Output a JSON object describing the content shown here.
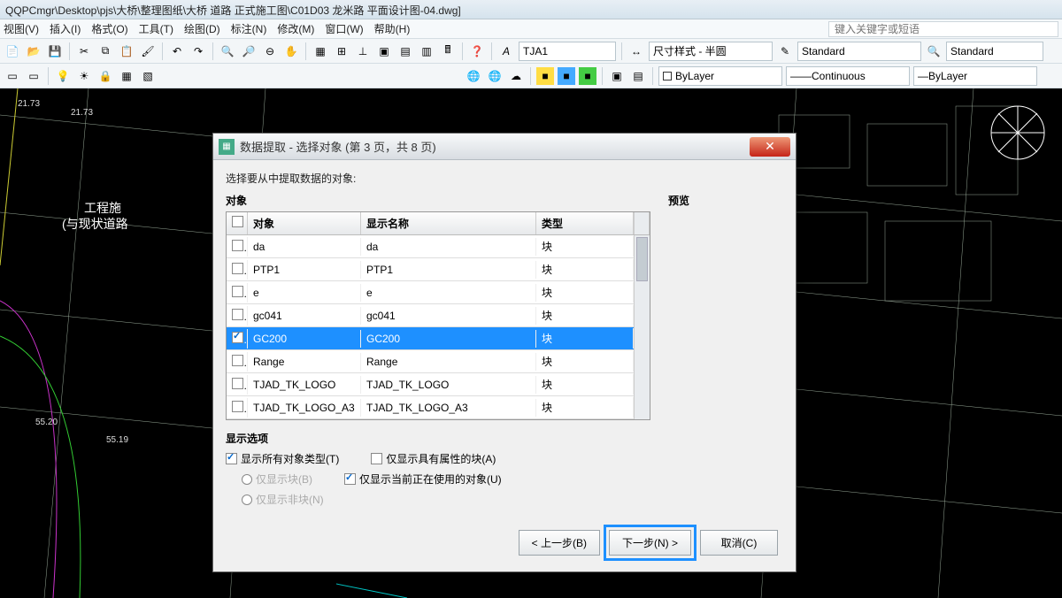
{
  "title_bar": "QQPCmgr\\Desktop\\pjs\\大桥\\整理图纸\\大桥 道路 正式施工图\\C01D03 龙米路 平面设计图-04.dwg]",
  "menu": {
    "items": [
      "视图(V)",
      "插入(I)",
      "格式(O)",
      "工具(T)",
      "绘图(D)",
      "标注(N)",
      "修改(M)",
      "窗口(W)",
      "帮助(H)"
    ],
    "hint": "键入关键字或短语"
  },
  "toolbars": {
    "style_combo1": "TJA1",
    "style_label": "尺寸样式 - 半圆",
    "standard1": "Standard",
    "standard2": "Standard",
    "layer": "ByLayer",
    "linetype": "Continuous",
    "lineweight": "ByLayer"
  },
  "dialog": {
    "title": "数据提取 - 选择对象 (第 3 页，共 8 页)",
    "instruction": "选择要从中提取数据的对象:",
    "objects_label": "对象",
    "preview_label": "预览",
    "headers": {
      "name": "对象",
      "display": "显示名称",
      "type": "类型"
    },
    "rows": [
      {
        "name": "da",
        "display": "da",
        "type": "块",
        "checked": false,
        "selected": false
      },
      {
        "name": "PTP1",
        "display": "PTP1",
        "type": "块",
        "checked": false,
        "selected": false
      },
      {
        "name": "e",
        "display": "e",
        "type": "块",
        "checked": false,
        "selected": false
      },
      {
        "name": "gc041",
        "display": "gc041",
        "type": "块",
        "checked": false,
        "selected": false
      },
      {
        "name": "GC200",
        "display": "GC200",
        "type": "块",
        "checked": true,
        "selected": true
      },
      {
        "name": "Range",
        "display": "Range",
        "type": "块",
        "checked": false,
        "selected": false
      },
      {
        "name": "TJAD_TK_LOGO",
        "display": "TJAD_TK_LOGO",
        "type": "块",
        "checked": false,
        "selected": false
      },
      {
        "name": "TJAD_TK_LOGO_A3",
        "display": "TJAD_TK_LOGO_A3",
        "type": "块",
        "checked": false,
        "selected": false
      }
    ],
    "options": {
      "header": "显示选项",
      "show_all_types": "显示所有对象类型(T)",
      "only_blocks": "仅显示块(B)",
      "only_nonblocks": "仅显示非块(N)",
      "only_with_attrs": "仅显示具有属性的块(A)",
      "only_in_use": "仅显示当前正在使用的对象(U)"
    },
    "buttons": {
      "back": "< 上一步(B)",
      "next": "下一步(N) >",
      "cancel": "取消(C)"
    }
  }
}
